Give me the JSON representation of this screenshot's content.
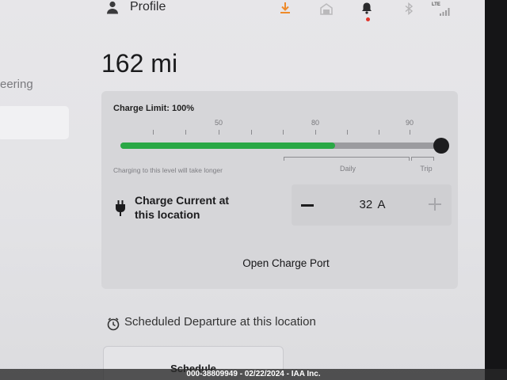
{
  "header": {
    "profile_label": "Profile",
    "network_label": "LTE",
    "icons": [
      "person-icon",
      "download-icon",
      "garage-icon",
      "bell-icon",
      "bluetooth-icon",
      "signal-icon"
    ]
  },
  "range": {
    "value": "162 mi"
  },
  "sidebar": {
    "partial_label": "eering"
  },
  "charging": {
    "limit_label": "Charge Limit: 100%",
    "tick_labels": [
      "50",
      "80",
      "90"
    ],
    "slider": {
      "limit_percent": 100,
      "current_fill_fraction": 0.67
    },
    "hint": "Charging to this level will take longer",
    "range_labels": {
      "daily": "Daily",
      "trip": "Trip"
    },
    "current": {
      "label_line1": "Charge Current at",
      "label_line2": "this location",
      "value": "32 A",
      "decrease_icon": "minus-icon",
      "increase_icon": "plus-icon"
    },
    "open_port_label": "Open Charge Port",
    "icon": "plug-icon"
  },
  "schedule": {
    "heading": "Scheduled Departure at this location",
    "button_label": "Schedule",
    "icon": "clock-icon"
  },
  "watermark": "000-38809949 - 02/22/2024 - IAA Inc.",
  "colors": {
    "accent_green": "#2aa845",
    "download_orange": "#ee8a2a",
    "alert_red": "#e0342a",
    "knob": "#1d1d1f"
  }
}
